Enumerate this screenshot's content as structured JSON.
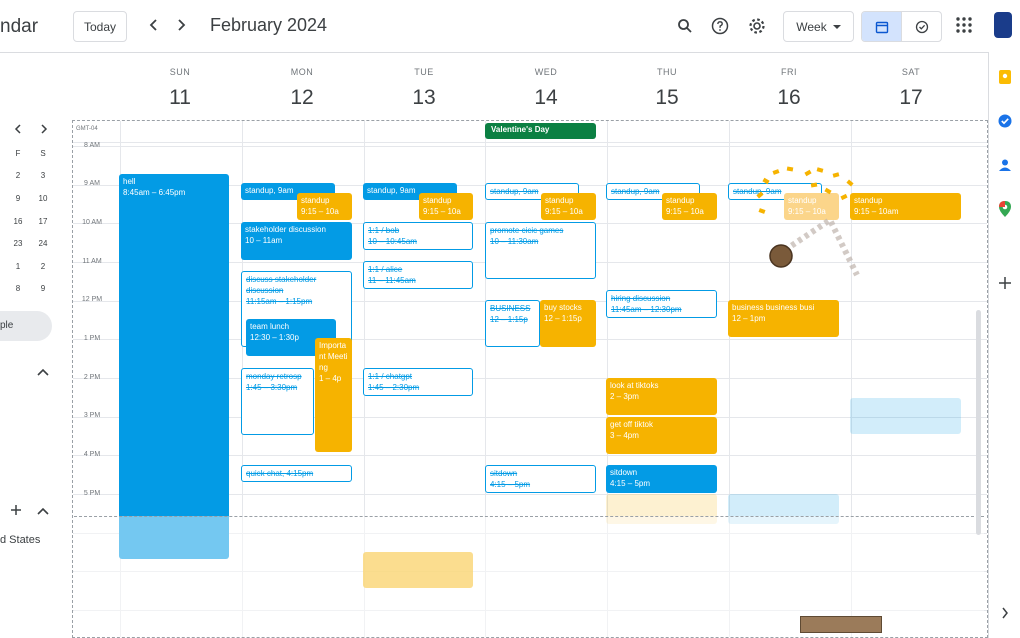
{
  "header": {
    "app_title": "ndar",
    "today_label": "Today",
    "month_label": "February 2024",
    "view_label": "Week"
  },
  "sidebar": {
    "mini_cal": [
      [
        "F",
        "S"
      ],
      [
        "2",
        "3"
      ],
      [
        "9",
        "10"
      ],
      [
        "16",
        "17"
      ],
      [
        "23",
        "24"
      ],
      [
        "1",
        "2"
      ],
      [
        "8",
        "9"
      ]
    ],
    "selected_label": "ple",
    "region_label": "d States"
  },
  "days": [
    {
      "name": "SUN",
      "num": "11"
    },
    {
      "name": "MON",
      "num": "12"
    },
    {
      "name": "TUE",
      "num": "13"
    },
    {
      "name": "WED",
      "num": "14"
    },
    {
      "name": "THU",
      "num": "15"
    },
    {
      "name": "FRI",
      "num": "16"
    },
    {
      "name": "SAT",
      "num": "17"
    }
  ],
  "timezone": "GMT-04",
  "times": [
    "8 AM",
    "9 AM",
    "10 AM",
    "11 AM",
    "12 PM",
    "1 PM",
    "2 PM",
    "3 PM",
    "4 PM",
    "5 PM"
  ],
  "allday": {
    "title": "Valentine's Day"
  },
  "events": [
    {
      "id": "hell",
      "title": "hell",
      "sub": "8:45am – 6:45pm",
      "style": "blue"
    },
    {
      "id": "mon-standup",
      "title": "standup, 9am",
      "sub": "",
      "style": "blue"
    },
    {
      "id": "mon-standup2",
      "title": "standup",
      "sub": "9:15 – 10a",
      "style": "yellow"
    },
    {
      "id": "mon-stake",
      "title": "stakeholder discussion",
      "sub": "10 – 11am",
      "style": "blue"
    },
    {
      "id": "mon-discuss",
      "title": "discuss stakeholder discussion",
      "sub": "11:15am – 1:15pm",
      "style": "out"
    },
    {
      "id": "mon-lunch",
      "title": "team lunch",
      "sub": "12:30 – 1:30p",
      "style": "blue"
    },
    {
      "id": "mon-important",
      "title": "Important Meeting",
      "sub": "1 – 4p",
      "style": "yellow"
    },
    {
      "id": "mon-retro",
      "title": "monday retrosp",
      "sub": "1:45 – 3:30pm",
      "style": "out"
    },
    {
      "id": "mon-quick",
      "title": "quick chat, 4:15pm",
      "sub": "",
      "style": "out"
    },
    {
      "id": "tue-standup",
      "title": "standup, 9am",
      "sub": "",
      "style": "blue"
    },
    {
      "id": "tue-standup2",
      "title": "standup",
      "sub": "9:15 – 10a",
      "style": "yellow"
    },
    {
      "id": "tue-bob",
      "title": "1:1 / bob",
      "sub": "10 – 10:45am",
      "style": "out"
    },
    {
      "id": "tue-alice",
      "title": "1:1 / alice",
      "sub": "11 – 11:45am",
      "style": "out"
    },
    {
      "id": "tue-chatgpt",
      "title": "1:1 / chatgpt",
      "sub": "1:45 – 2:30pm",
      "style": "out"
    },
    {
      "id": "wed-standup",
      "title": "standup, 9am",
      "sub": "",
      "style": "out"
    },
    {
      "id": "wed-standup2",
      "title": "standup",
      "sub": "9:15 – 10a",
      "style": "yellow"
    },
    {
      "id": "wed-promote",
      "title": "promote cicic games",
      "sub": "10 – 11:30am",
      "style": "out"
    },
    {
      "id": "wed-business",
      "title": "BUSINESS",
      "sub": "12 – 1:15p",
      "style": "out"
    },
    {
      "id": "wed-stocks",
      "title": "buy stocks",
      "sub": "12 – 1:15p",
      "style": "yellow"
    },
    {
      "id": "wed-sitdown",
      "title": "sitdown",
      "sub": "4:15 – 5pm",
      "style": "out"
    },
    {
      "id": "thu-standup",
      "title": "standup, 9am",
      "sub": "",
      "style": "out"
    },
    {
      "id": "thu-standup2",
      "title": "standup",
      "sub": "9:15 – 10a",
      "style": "yellow"
    },
    {
      "id": "thu-hiring",
      "title": "hiring discussion",
      "sub": "11:45am – 12:30pm",
      "style": "out"
    },
    {
      "id": "thu-tiktok",
      "title": "look at tiktoks",
      "sub": "2 – 3pm",
      "style": "yellow"
    },
    {
      "id": "thu-offtiktok",
      "title": "get off tiktok",
      "sub": "3 – 4pm",
      "style": "yellow"
    },
    {
      "id": "thu-sitdown",
      "title": "sitdown",
      "sub": "4:15 – 5pm",
      "style": "blue"
    },
    {
      "id": "fri-standup",
      "title": "standup, 9am",
      "sub": "",
      "style": "out"
    },
    {
      "id": "fri-standup2",
      "title": "standup",
      "sub": "9:15 – 10a",
      "style": "yellow"
    },
    {
      "id": "fri-business",
      "title": "business business busi",
      "sub": "12 – 1pm",
      "style": "yellow"
    },
    {
      "id": "sat-standup",
      "title": "standup",
      "sub": "9:15 – 10am",
      "style": "yellow"
    }
  ],
  "colors": {
    "blue": "#039be5",
    "yellow": "#f6b300",
    "green": "#0b8043",
    "border": "#dadce0"
  },
  "icons": [
    "search-icon",
    "help-icon",
    "settings-icon",
    "calendar-view-icon",
    "tasks-view-icon",
    "apps-grid-icon",
    "keep-icon",
    "tasks-icon",
    "contacts-icon",
    "maps-icon",
    "add-icon",
    "chevron-right-icon"
  ]
}
